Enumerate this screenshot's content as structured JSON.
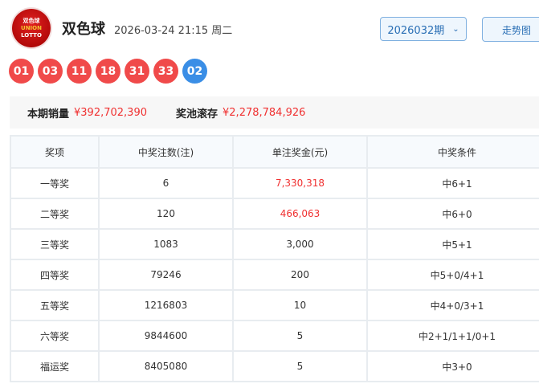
{
  "header": {
    "logo_text": [
      "双色球",
      "UNION",
      "LOTTO"
    ],
    "title": "双色球",
    "date": "2026-03-24 21:15 周二",
    "issue": "2026032期",
    "trend_label": "走势图"
  },
  "balls": {
    "red": [
      "01",
      "03",
      "11",
      "18",
      "31",
      "33"
    ],
    "blue": [
      "02"
    ]
  },
  "summary": {
    "sales_label": "本期销量",
    "sales_value": "¥392,702,390",
    "pool_label": "奖池滚存",
    "pool_value": "¥2,278,784,926"
  },
  "table": {
    "headers": [
      "奖项",
      "中奖注数(注)",
      "单注奖金(元)",
      "中奖条件"
    ],
    "rows": [
      [
        "一等奖",
        "6",
        "7,330,318",
        "中6+1"
      ],
      [
        "二等奖",
        "120",
        "466,063",
        "中6+0"
      ],
      [
        "三等奖",
        "1083",
        "3,000",
        "中5+1"
      ],
      [
        "四等奖",
        "79246",
        "200",
        "中5+0/4+1"
      ],
      [
        "五等奖",
        "1216803",
        "10",
        "中4+0/3+1"
      ],
      [
        "六等奖",
        "9844600",
        "5",
        "中2+1/1+1/0+1"
      ],
      [
        "福运奖",
        "8405080",
        "5",
        "中3+0"
      ]
    ]
  },
  "colors": {
    "red_ball": "#f04a4a",
    "blue_ball": "#3a8ee6",
    "highlight": "#f03030"
  }
}
